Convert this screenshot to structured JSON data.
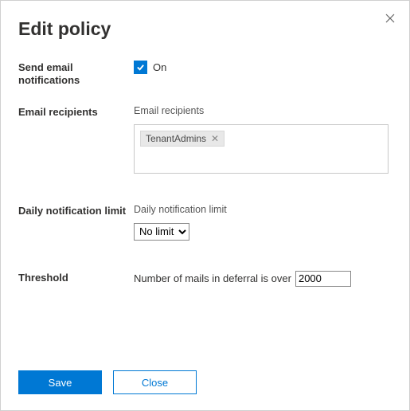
{
  "title": "Edit policy",
  "sections": {
    "sendEmail": {
      "label": "Send email notifications",
      "checkboxText": "On",
      "checked": true
    },
    "recipients": {
      "label": "Email recipients",
      "fieldLabel": "Email recipients",
      "chips": [
        "TenantAdmins"
      ]
    },
    "dailyLimit": {
      "label": "Daily notification limit",
      "fieldLabel": "Daily notification limit",
      "selected": "No limit"
    },
    "threshold": {
      "label": "Threshold",
      "text": "Number of mails in deferral is over",
      "value": "2000"
    }
  },
  "buttons": {
    "save": "Save",
    "close": "Close"
  }
}
